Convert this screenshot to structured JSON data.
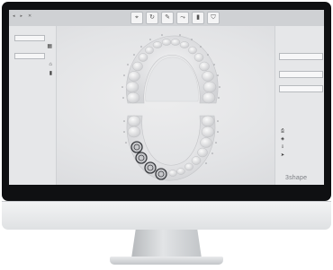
{
  "window": {
    "controls": [
      "◂",
      "▸",
      "✕"
    ],
    "patient_lines": [
      "",
      ""
    ]
  },
  "toolbar": {
    "tools": [
      {
        "icon": "select-tool-icon",
        "glyph": "⌖"
      },
      {
        "icon": "rotate-tool-icon",
        "glyph": "↻"
      },
      {
        "icon": "measure-tool-icon",
        "glyph": "✎"
      },
      {
        "icon": "lasso-tool-icon",
        "glyph": "⤳"
      },
      {
        "icon": "implant-tool-icon",
        "glyph": "▮"
      },
      {
        "icon": "tooth-tool-icon",
        "glyph": "⛉"
      }
    ]
  },
  "left_panel": {
    "icons": {
      "calendar": "▦",
      "scan": "⌂",
      "tooth": "▮"
    }
  },
  "right_panel": {
    "icons": {
      "instructions": "⎙",
      "images": "◈",
      "export": "⇩",
      "send": "➤"
    }
  },
  "brand": {
    "name": "3shape"
  },
  "colors": {
    "screen_bg": "#e3e4e6",
    "panel_bg": "#e6e7e9",
    "bezel": "#0f1012",
    "implant_marker": "#3a3c40"
  }
}
